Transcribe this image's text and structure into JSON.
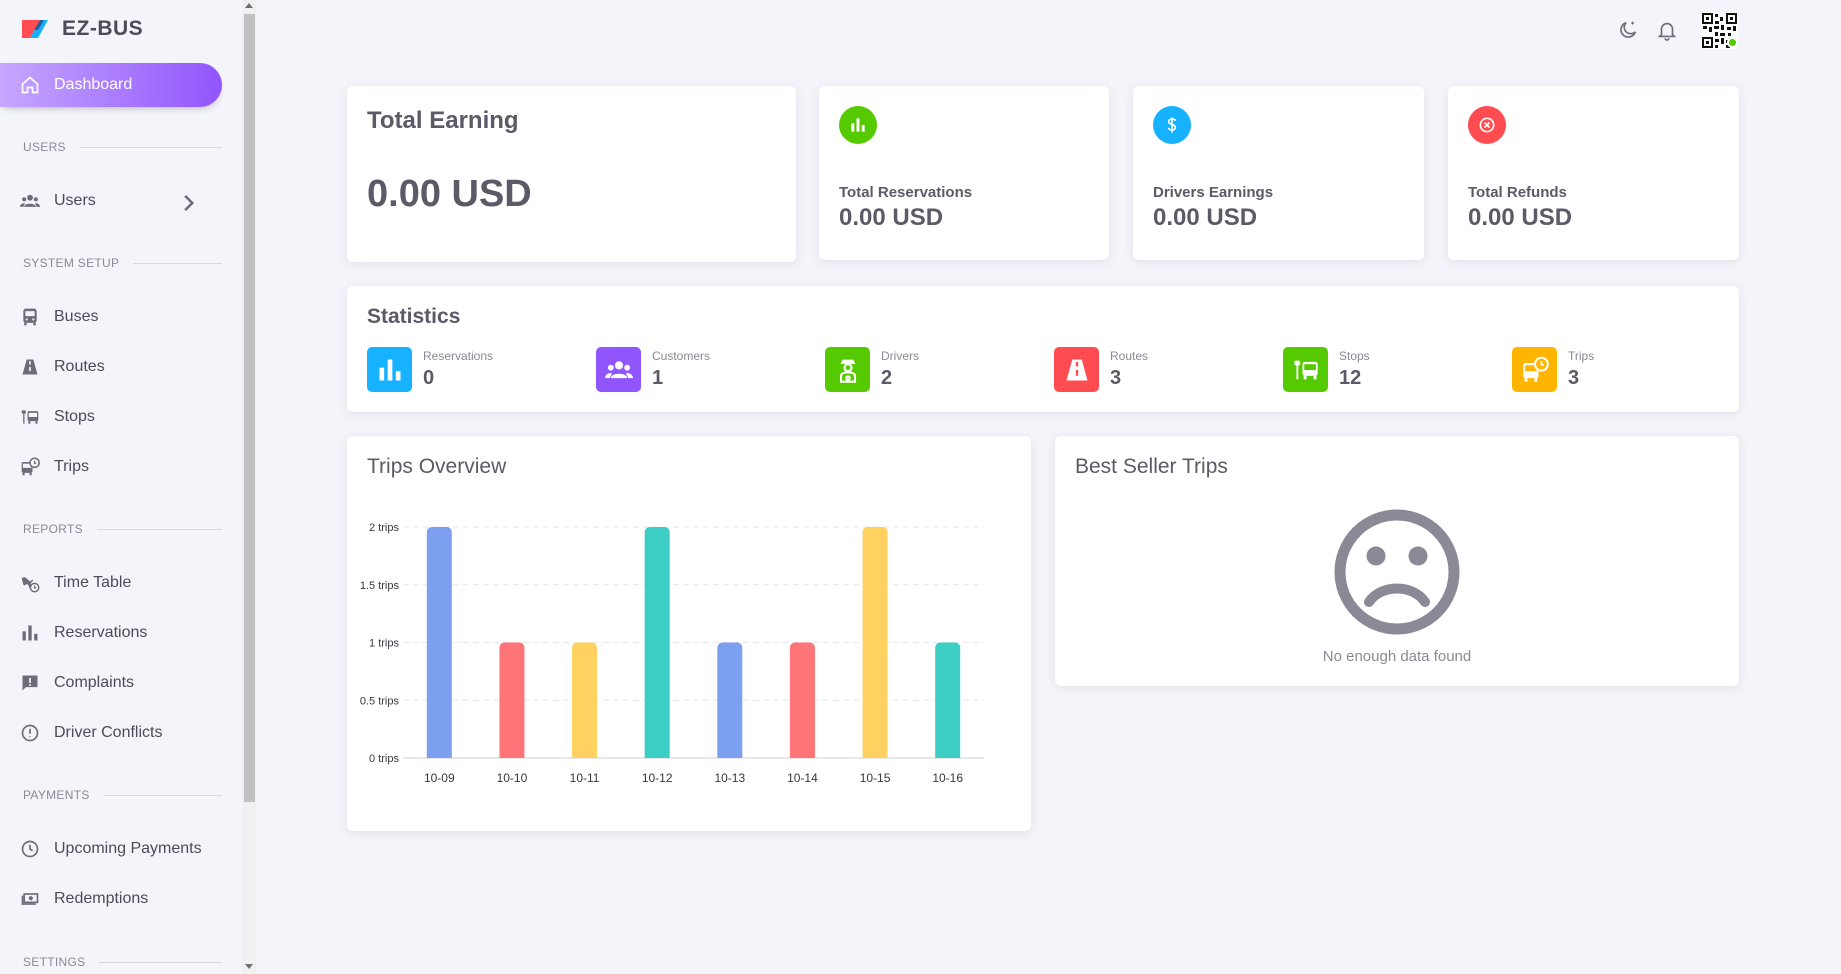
{
  "brand": {
    "name": "EZ-BUS"
  },
  "sidebar": {
    "active": {
      "label": "Dashboard",
      "icon": "home-icon"
    },
    "sections": [
      {
        "title": "USERS",
        "items": [
          {
            "label": "Users",
            "icon": "users-icon",
            "has_children": true
          }
        ]
      },
      {
        "title": "SYSTEM SETUP",
        "items": [
          {
            "label": "Buses",
            "icon": "bus-icon"
          },
          {
            "label": "Routes",
            "icon": "road-icon"
          },
          {
            "label": "Stops",
            "icon": "bus-stop-icon"
          },
          {
            "label": "Trips",
            "icon": "bus-clock-icon"
          }
        ]
      },
      {
        "title": "REPORTS",
        "items": [
          {
            "label": "Time Table",
            "icon": "airplane-clock-icon"
          },
          {
            "label": "Reservations",
            "icon": "bar-chart-icon"
          },
          {
            "label": "Complaints",
            "icon": "message-alert-icon"
          },
          {
            "label": "Driver Conflicts",
            "icon": "alert-circle-icon"
          }
        ]
      },
      {
        "title": "PAYMENTS",
        "items": [
          {
            "label": "Upcoming Payments",
            "icon": "clock-icon"
          },
          {
            "label": "Redemptions",
            "icon": "cash-icon"
          }
        ]
      },
      {
        "title": "SETTINGS",
        "items": []
      }
    ]
  },
  "topbar": {
    "icons": [
      "moon-icon",
      "bell-icon"
    ],
    "avatar": "qr-avatar",
    "online_color": "#56ca00"
  },
  "summary": {
    "total_earning": {
      "title": "Total Earning",
      "value": "0.00 USD"
    },
    "cards": [
      {
        "label": "Total Reservations",
        "value": "0.00 USD",
        "icon": "bar-chart-icon",
        "color": "#56ca00"
      },
      {
        "label": "Drivers Earnings",
        "value": "0.00 USD",
        "icon": "dollar-icon",
        "color": "#16b1ff"
      },
      {
        "label": "Total Refunds",
        "value": "0.00 USD",
        "icon": "close-circle-icon",
        "color": "#ff4c51"
      }
    ]
  },
  "statistics": {
    "title": "Statistics",
    "items": [
      {
        "label": "Reservations",
        "value": "0",
        "color": "#16b1ff",
        "icon": "bar-chart-icon"
      },
      {
        "label": "Customers",
        "value": "1",
        "color": "#9155fd",
        "icon": "users-icon"
      },
      {
        "label": "Drivers",
        "value": "2",
        "color": "#56ca00",
        "icon": "driver-icon"
      },
      {
        "label": "Routes",
        "value": "3",
        "color": "#ff4c51",
        "icon": "road-icon"
      },
      {
        "label": "Stops",
        "value": "12",
        "color": "#56ca00",
        "icon": "bus-stop-icon"
      },
      {
        "label": "Trips",
        "value": "3",
        "color": "#ffb400",
        "icon": "bus-clock-icon"
      }
    ]
  },
  "trips_overview": {
    "title": "Trips Overview"
  },
  "best_seller": {
    "title": "Best Seller Trips",
    "empty_text": "No enough data found",
    "icon": "sad-face-icon"
  },
  "chart_data": {
    "type": "bar",
    "categories": [
      "10-09",
      "10-10",
      "10-11",
      "10-12",
      "10-13",
      "10-14",
      "10-15",
      "10-16"
    ],
    "values": [
      2,
      1,
      1,
      2,
      1,
      1,
      2,
      1
    ],
    "colors": [
      "#7c9ff0",
      "#ff7476",
      "#ffd160",
      "#3ccec4",
      "#7c9ff0",
      "#ff7476",
      "#ffd160",
      "#3ccec4"
    ],
    "y_ticks": [
      "0 trips",
      "0.5 trips",
      "1 trips",
      "1.5 trips",
      "2 trips"
    ],
    "ylim": [
      0,
      2
    ],
    "grid": true
  }
}
